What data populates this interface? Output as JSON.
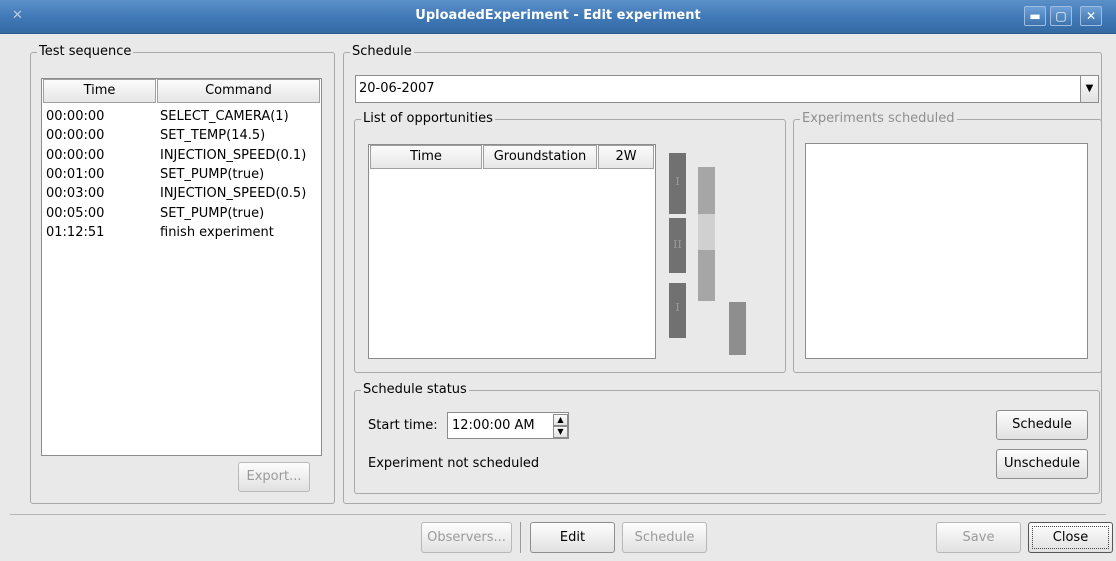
{
  "window": {
    "title": "UploadedExperiment - Edit experiment"
  },
  "test_sequence": {
    "title": "Test sequence",
    "columns": [
      "Time",
      "Command"
    ],
    "rows": [
      {
        "time": "00:00:00",
        "command": "SELECT_CAMERA(1)"
      },
      {
        "time": "00:00:00",
        "command": "SET_TEMP(14.5)"
      },
      {
        "time": "00:00:00",
        "command": "INJECTION_SPEED(0.1)"
      },
      {
        "time": "00:01:00",
        "command": "SET_PUMP(true)"
      },
      {
        "time": "00:03:00",
        "command": "INJECTION_SPEED(0.5)"
      },
      {
        "time": "00:05:00",
        "command": "SET_PUMP(true)"
      },
      {
        "time": "01:12:51",
        "command": "finish experiment"
      }
    ],
    "export_label": "Export..."
  },
  "schedule": {
    "title": "Schedule",
    "date": "20-06-2007",
    "opportunities": {
      "title": "List of opportunities",
      "columns": [
        "Time",
        "Groundstation",
        "2W"
      ]
    },
    "timeline_labels": [
      "I",
      "II",
      "I"
    ],
    "experiments_scheduled": {
      "title": "Experiments scheduled"
    },
    "status": {
      "title": "Schedule status",
      "start_time_label": "Start time:",
      "start_time_value": "12:00:00 AM",
      "state_text": "Experiment not scheduled",
      "schedule_label": "Schedule",
      "unschedule_label": "Unschedule"
    }
  },
  "footer": {
    "observers_label": "Observers...",
    "edit_label": "Edit",
    "schedule_label": "Schedule",
    "save_label": "Save",
    "close_label": "Close"
  },
  "colors": {
    "titlebar": "#3f78b6",
    "dark_bar": "#717171",
    "light_bar": "#a6a6a6"
  }
}
